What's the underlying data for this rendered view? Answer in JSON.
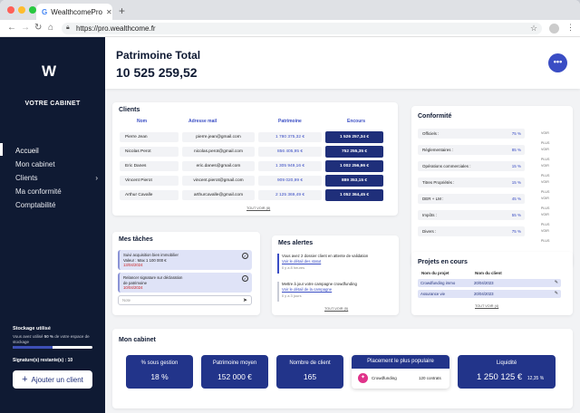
{
  "browser": {
    "tab_title": "WealthcomePro",
    "tab_icon": "G",
    "url": "https://pro.wealthcome.fr"
  },
  "sidebar": {
    "logo": "W",
    "title": "VOTRE CABINET",
    "items": [
      {
        "label": "Accueil",
        "active": true
      },
      {
        "label": "Mon cabinet"
      },
      {
        "label": "Clients",
        "has_children": true
      },
      {
        "label": "Ma conformité"
      },
      {
        "label": "Comptabilité"
      }
    ],
    "storage_title": "Stockage utilisé",
    "storage_text_1": "Vous avez utilisé ",
    "storage_pct_text": "50 %",
    "storage_text_2": " de votre espace de stockage",
    "storage_fraction": 0.5,
    "signatures_label": "Signature(s) restante(s) : ",
    "signatures_value": "10",
    "add_client_label": "Ajouter un client"
  },
  "header": {
    "label": "Patrimoine Total",
    "value": "10 525 259,52",
    "menu_icon": "more-dots-icon"
  },
  "clients": {
    "title": "Clients",
    "columns": [
      "Nom",
      "Adresse mail",
      "Patrimoine",
      "Encours"
    ],
    "rows": [
      {
        "name": "Pierre Jean",
        "email": "pierre.jean@gmail.com",
        "patrimoine": "1 780 375,32 €",
        "encours": "1 526 257,34 €"
      },
      {
        "name": "Nicolas Perot",
        "email": "nicolas.perot@gmail.com",
        "patrimoine": "856 405,95 €",
        "encours": "752 255,35 €"
      },
      {
        "name": "Eric Danes",
        "email": "eric.danes@gmail.com",
        "patrimoine": "1 305 949,16 €",
        "encours": "1 002 256,96 €"
      },
      {
        "name": "Vincent Pierot",
        "email": "vincent.pierot@gmail.com",
        "patrimoine": "909 020,99 €",
        "encours": "889 353,15 €"
      },
      {
        "name": "Arthur Cavalle",
        "email": "arthurcavalle@gmail.com",
        "patrimoine": "2 125 369,49 €",
        "encours": "1 052 364,45 €"
      }
    ],
    "see_all": "TOUT VOIR (8)"
  },
  "conformite": {
    "title": "Conformité",
    "rows": [
      {
        "label": "Officiels :",
        "pct": "75 %"
      },
      {
        "label": "Réglementaires :",
        "pct": "85 %"
      },
      {
        "label": "Opérations commerciales :",
        "pct": "15 %"
      },
      {
        "label": "Titres Propriétés :",
        "pct": "15 %"
      },
      {
        "label": "DER + LM :",
        "pct": "45 %"
      },
      {
        "label": "Impôts :",
        "pct": "55 %"
      },
      {
        "label": "Divers :",
        "pct": "75 %"
      }
    ],
    "row_link": "VOIR PLUS"
  },
  "taches": {
    "title": "Mes tâches",
    "items": [
      {
        "line1": "Suivi acquisition bien immobilier",
        "line2": "Valeur : Max 1 100 000 €",
        "date": "13/04/2024"
      },
      {
        "line1": "Relancer signature sur déclaration",
        "line2": "de patrimoine",
        "date": "10/04/2024"
      }
    ],
    "input_placeholder": "Note"
  },
  "alertes": {
    "title": "Mes alertes",
    "items": [
      {
        "text": "Vous avez 2 dossier client en attente de validation",
        "link": "Voir le détail des statut",
        "ago": "Il y a 8 heures"
      },
      {
        "text": "Mettre à jour votre campagne crowdfunding",
        "link": "Voir le détail de la campagne",
        "ago": "Il y a 3 jours"
      }
    ],
    "see_all": "TOUT VOIR (5)"
  },
  "projets": {
    "title": "Projets en cours",
    "columns": [
      "Nom du projet",
      "Nom du client"
    ],
    "rows": [
      {
        "name": "Crowdfunding immo",
        "date": "20/04/2023"
      },
      {
        "name": "Assurance vie",
        "date": "20/04/2023"
      }
    ],
    "see_all": "TOUT VOIR (4)"
  },
  "cabinet": {
    "title": "Mon cabinet",
    "kpis": [
      {
        "label": "% sous gestion",
        "value": "18 %"
      },
      {
        "label": "Patrimoine moyen",
        "value": "152 000 €"
      },
      {
        "label": "Nombre de client",
        "value": "165"
      }
    ],
    "placement": {
      "label": "Placement le plus populaire",
      "name": "Crowdfunding",
      "count": "120 contrats"
    },
    "liquidite": {
      "label": "Liquidité",
      "value": "1 250 125 €",
      "pct": "12,35 %"
    }
  },
  "colors": {
    "navy": "#0f1a33",
    "accent": "#3a4dc4",
    "dark_blue": "#1f2f7a",
    "kpi_blue": "#22348a"
  }
}
